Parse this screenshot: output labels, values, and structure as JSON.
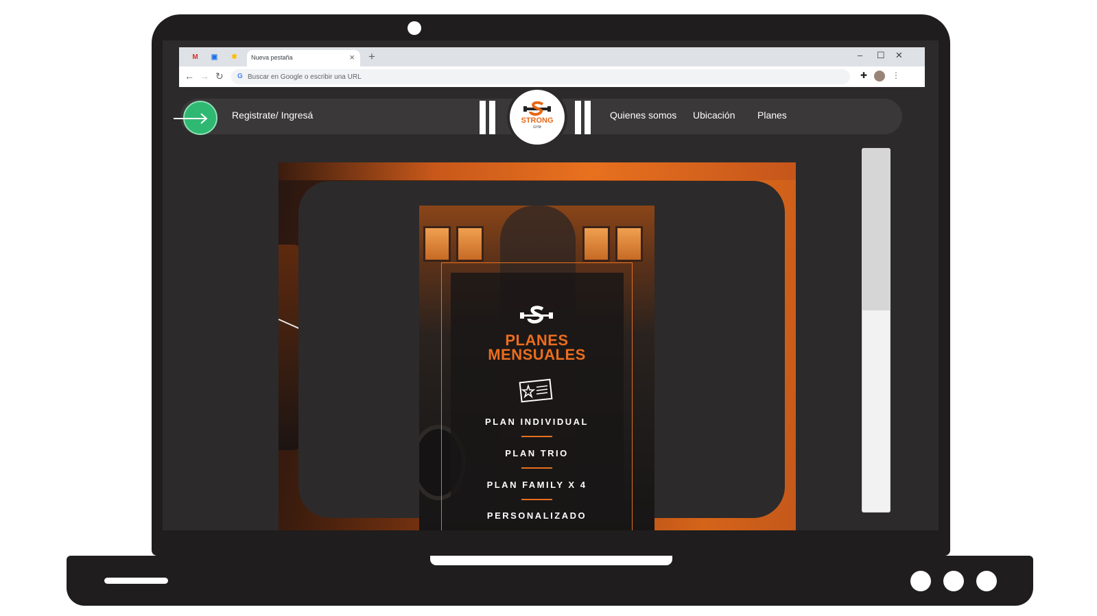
{
  "browser": {
    "tab_title": "Nueva pestaña",
    "tab_close": "×",
    "new_tab": "+",
    "omnibox_placeholder": "Buscar en Google o escribir una URL",
    "favicons": [
      "gmail-icon",
      "calendar-icon",
      "photos-icon"
    ],
    "window_controls": {
      "minimize": "–",
      "maximize": "☐",
      "close": "✕"
    },
    "nav": {
      "back": "←",
      "forward": "→",
      "reload": "↻"
    },
    "google_letter": "G",
    "menu": "⋮"
  },
  "site": {
    "nav": {
      "register_label": "Registrate/ Ingresá",
      "links": [
        "Quienes somos",
        "Ubicación",
        "Planes"
      ]
    },
    "logo": {
      "word": "STRONG",
      "sub": "GYM"
    },
    "poster": {
      "title_line1": "PLANES",
      "title_line2": "MENSUALES",
      "plans": [
        "PLAN INDIVIDUAL",
        "PLAN TRIO",
        "PLAN FAMILY X 4",
        "PERSONALIZADO"
      ]
    }
  },
  "colors": {
    "accent_orange": "#e8711f",
    "login_green": "#2fb872",
    "site_dark": "#2c2a2a",
    "laptop_body": "#1f1d1d"
  },
  "scrollbar": {
    "position_fraction": 0.0
  }
}
